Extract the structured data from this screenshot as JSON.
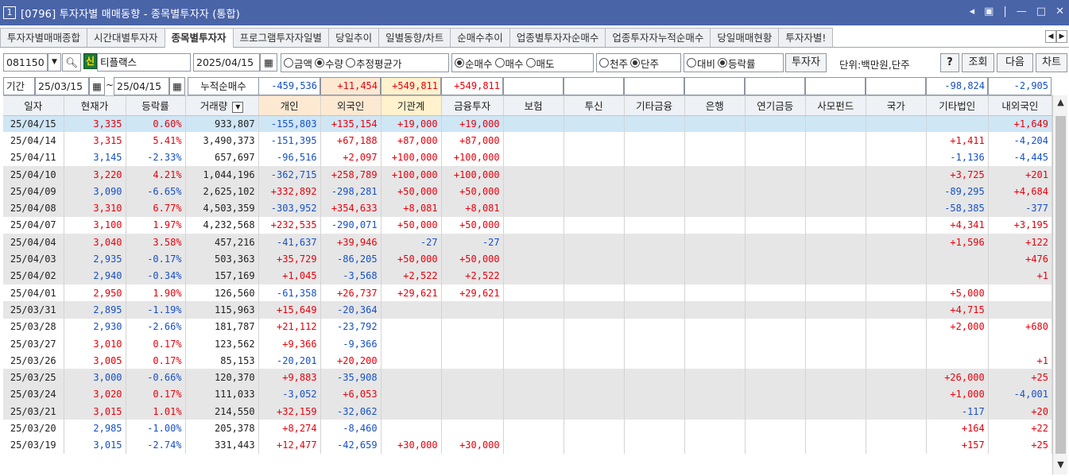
{
  "window": {
    "num": "1",
    "title": "[0796] 투자자별 매매동향 - 종목별투자자 (통합)"
  },
  "tabs": [
    "투자자별매매종합",
    "시간대별투자자",
    "종목별투자자",
    "프로그램투자자일별",
    "당일추이",
    "일별동향/차트",
    "순매수추이",
    "업종별투자자순매수",
    "업종투자자누적순매수",
    "당일매매현황",
    "투자자별!"
  ],
  "active_tab": 2,
  "controls": {
    "code": "081150",
    "sin": "신",
    "stock_name": "티플랙스",
    "date": "2025/04/15",
    "radio1": {
      "opts": [
        "금액",
        "수량",
        "추정평균가"
      ],
      "sel": 1
    },
    "radio2": {
      "opts": [
        "순매수",
        "매수",
        "매도"
      ],
      "sel": 0
    },
    "radio3": {
      "opts": [
        "천주",
        "단주"
      ],
      "sel": 1
    },
    "radio4": {
      "opts": [
        "대비",
        "등락률"
      ],
      "sel": 1
    },
    "investor_btn": "투자자",
    "unit": "단위:백만원,단주",
    "help": "?",
    "query": "조회",
    "next": "다음",
    "chart": "차트"
  },
  "period": {
    "label": "기간",
    "from": "25/03/15",
    "tilde": "~",
    "to": "25/04/15",
    "cum_label": "누적순매수"
  },
  "summary": [
    "-459,536",
    "+11,454",
    "+549,811",
    "+549,811",
    "",
    "",
    "",
    "",
    "",
    "",
    "",
    "-98,824",
    "-2,905"
  ],
  "headers": [
    "일자",
    "현재가",
    "등락률",
    "거래량",
    "개인",
    "외국인",
    "기관계",
    "금융투자",
    "보험",
    "투신",
    "기타금융",
    "은행",
    "연기금등",
    "사모펀드",
    "국가",
    "기타법인",
    "내외국인"
  ],
  "rows": [
    [
      "25/04/15",
      "3,335",
      "0.60%",
      "933,807",
      "-155,803",
      "+135,154",
      "+19,000",
      "+19,000",
      "",
      "",
      "",
      "",
      "",
      "",
      "",
      "",
      "+1,649"
    ],
    [
      "25/04/14",
      "3,315",
      "5.41%",
      "3,490,373",
      "-151,395",
      "+67,188",
      "+87,000",
      "+87,000",
      "",
      "",
      "",
      "",
      "",
      "",
      "",
      "+1,411",
      "-4,204"
    ],
    [
      "25/04/11",
      "3,145",
      "-2.33%",
      "657,697",
      "-96,516",
      "+2,097",
      "+100,000",
      "+100,000",
      "",
      "",
      "",
      "",
      "",
      "",
      "",
      "-1,136",
      "-4,445"
    ],
    [
      "25/04/10",
      "3,220",
      "4.21%",
      "1,044,196",
      "-362,715",
      "+258,789",
      "+100,000",
      "+100,000",
      "",
      "",
      "",
      "",
      "",
      "",
      "",
      "+3,725",
      "+201"
    ],
    [
      "25/04/09",
      "3,090",
      "-6.65%",
      "2,625,102",
      "+332,892",
      "-298,281",
      "+50,000",
      "+50,000",
      "",
      "",
      "",
      "",
      "",
      "",
      "",
      "-89,295",
      "+4,684"
    ],
    [
      "25/04/08",
      "3,310",
      "6.77%",
      "4,503,359",
      "-303,952",
      "+354,633",
      "+8,081",
      "+8,081",
      "",
      "",
      "",
      "",
      "",
      "",
      "",
      "-58,385",
      "-377"
    ],
    [
      "25/04/07",
      "3,100",
      "1.97%",
      "4,232,568",
      "+232,535",
      "-290,071",
      "+50,000",
      "+50,000",
      "",
      "",
      "",
      "",
      "",
      "",
      "",
      "+4,341",
      "+3,195"
    ],
    [
      "25/04/04",
      "3,040",
      "3.58%",
      "457,216",
      "-41,637",
      "+39,946",
      "-27",
      "-27",
      "",
      "",
      "",
      "",
      "",
      "",
      "",
      "+1,596",
      "+122"
    ],
    [
      "25/04/03",
      "2,935",
      "-0.17%",
      "503,363",
      "+35,729",
      "-86,205",
      "+50,000",
      "+50,000",
      "",
      "",
      "",
      "",
      "",
      "",
      "",
      "",
      "+476"
    ],
    [
      "25/04/02",
      "2,940",
      "-0.34%",
      "157,169",
      "+1,045",
      "-3,568",
      "+2,522",
      "+2,522",
      "",
      "",
      "",
      "",
      "",
      "",
      "",
      "",
      "+1"
    ],
    [
      "25/04/01",
      "2,950",
      "1.90%",
      "126,560",
      "-61,358",
      "+26,737",
      "+29,621",
      "+29,621",
      "",
      "",
      "",
      "",
      "",
      "",
      "",
      "+5,000",
      ""
    ],
    [
      "25/03/31",
      "2,895",
      "-1.19%",
      "115,963",
      "+15,649",
      "-20,364",
      "",
      "",
      "",
      "",
      "",
      "",
      "",
      "",
      "",
      "+4,715",
      ""
    ],
    [
      "25/03/28",
      "2,930",
      "-2.66%",
      "181,787",
      "+21,112",
      "-23,792",
      "",
      "",
      "",
      "",
      "",
      "",
      "",
      "",
      "",
      "+2,000",
      "+680"
    ],
    [
      "25/03/27",
      "3,010",
      "0.17%",
      "123,562",
      "+9,366",
      "-9,366",
      "",
      "",
      "",
      "",
      "",
      "",
      "",
      "",
      "",
      "",
      ""
    ],
    [
      "25/03/26",
      "3,005",
      "0.17%",
      "85,153",
      "-20,201",
      "+20,200",
      "",
      "",
      "",
      "",
      "",
      "",
      "",
      "",
      "",
      "",
      "+1"
    ],
    [
      "25/03/25",
      "3,000",
      "-0.66%",
      "120,370",
      "+9,883",
      "-35,908",
      "",
      "",
      "",
      "",
      "",
      "",
      "",
      "",
      "",
      "+26,000",
      "+25"
    ],
    [
      "25/03/24",
      "3,020",
      "0.17%",
      "111,033",
      "-3,052",
      "+6,053",
      "",
      "",
      "",
      "",
      "",
      "",
      "",
      "",
      "",
      "+1,000",
      "-4,001"
    ],
    [
      "25/03/21",
      "3,015",
      "1.01%",
      "214,550",
      "+32,159",
      "-32,062",
      "",
      "",
      "",
      "",
      "",
      "",
      "",
      "",
      "",
      "-117",
      "+20"
    ],
    [
      "25/03/20",
      "2,985",
      "-1.00%",
      "205,378",
      "+8,274",
      "-8,460",
      "",
      "",
      "",
      "",
      "",
      "",
      "",
      "",
      "",
      "+164",
      "+22"
    ],
    [
      "25/03/19",
      "3,015",
      "-2.74%",
      "331,443",
      "+12,477",
      "-42,659",
      "+30,000",
      "+30,000",
      "",
      "",
      "",
      "",
      "",
      "",
      "",
      "+157",
      "+25"
    ]
  ],
  "icons": [
    "calendar-icon",
    "search-icon",
    "dropdown-icon",
    "sort-icon",
    "scroll-up-icon",
    "scroll-down-icon",
    "minimize-icon",
    "maximize-icon",
    "close-icon",
    "restore-icon"
  ]
}
